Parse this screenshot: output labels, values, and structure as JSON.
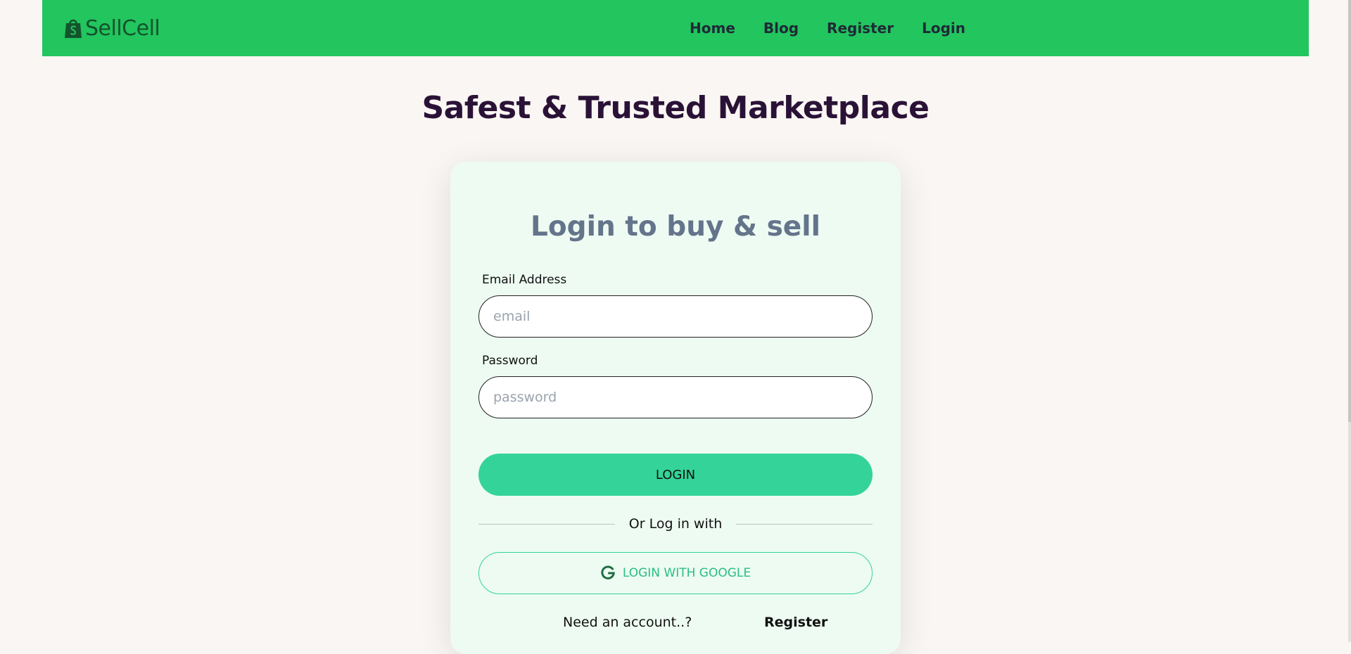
{
  "navbar": {
    "brand": "SellCell",
    "brand_icon": "shopping-bag-icon",
    "links": [
      "Home",
      "Blog",
      "Register",
      "Login"
    ]
  },
  "hero": {
    "title": "Safest & Trusted Marketplace"
  },
  "login_card": {
    "title": "Login to buy & sell",
    "email": {
      "label": "Email Address",
      "placeholder": "email",
      "value": ""
    },
    "password": {
      "label": "Password",
      "placeholder": "password",
      "value": ""
    },
    "login_button": "LOGIN",
    "divider_text": "Or Log in with",
    "google_button": "LOGIN WITH GOOGLE",
    "google_icon": "google-icon",
    "need_account": "Need an account..?",
    "register_link": "Register"
  },
  "colors": {
    "navbar": "#22c55e",
    "accent": "#34d399",
    "card_bg": "#edfbf2",
    "page_bg": "#faf6f3",
    "hero_text": "#2a1237",
    "card_title": "#64748b"
  }
}
